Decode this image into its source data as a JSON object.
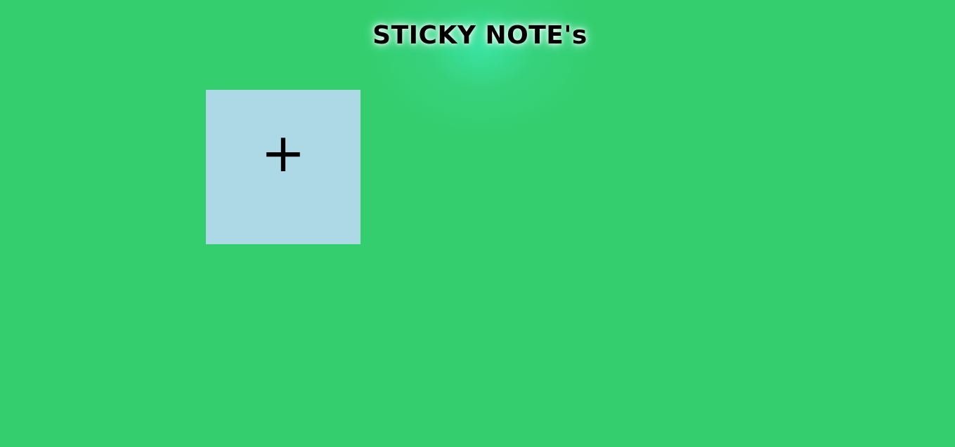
{
  "app": {
    "title": "STICKY NOTE's"
  },
  "add_note": {
    "icon": "plus-icon",
    "glyph": "+"
  },
  "colors": {
    "background": "#34ce6e",
    "note_background": "#add8e6",
    "title_text": "#000000"
  }
}
